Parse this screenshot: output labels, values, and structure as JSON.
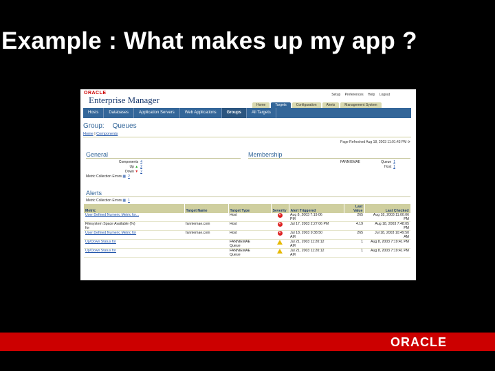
{
  "slide": {
    "title": "Example : What makes up my app ?",
    "footer_logo": "ORACLE"
  },
  "em": {
    "logo": "ORACLE",
    "title": "Enterprise Manager",
    "top_links": [
      "Setup",
      "Preferences",
      "Help",
      "Logout"
    ],
    "tabs": [
      "Home",
      "Targets",
      "Configuration",
      "Alerts",
      "Management System"
    ],
    "subnav": [
      "Hosts",
      "Databases",
      "Application Servers",
      "Web Applications",
      "Groups",
      "All Targets"
    ],
    "page_header": {
      "group": "Group:",
      "name": "Queues"
    },
    "breadcrumb": {
      "home": "Home",
      "current": "Components"
    },
    "refresh": "Page Refreshed Aug 18, 2003 11:01:43 PM",
    "general": {
      "title": "General",
      "rows": [
        {
          "label": "Components",
          "value": "4"
        },
        {
          "label": "Up",
          "value": "2"
        },
        {
          "label": "Down",
          "value": "2"
        },
        {
          "label": "Metric Collection Errors",
          "value": "2"
        }
      ]
    },
    "membership": {
      "title": "Membership",
      "owner": "FANNIEMAE",
      "items": [
        {
          "label": "Queue",
          "value": "1"
        },
        {
          "label": "Host",
          "value": "1"
        }
      ]
    },
    "alerts": {
      "title": "Alerts",
      "mce_label": "Metric Collection Errors",
      "mce_value": "1",
      "columns": [
        "Metric",
        "Target Name",
        "Target Type",
        "Severity",
        "Alert Triggered",
        "Last Value",
        "Last Checked"
      ],
      "rows": [
        {
          "metric": "User Defined Numeric Metric for...",
          "target": "",
          "type": "Host",
          "severity": "critical",
          "triggered": "Aug 8, 2003 7:19:06",
          "triggered2": "PM",
          "value": "265",
          "checked": "Aug 18, 2003 11:00:06",
          "checked2": "PM"
        },
        {
          "metric": "Filesystem Space Available (%)",
          "metric2": "for",
          "target": "fanniemae.com",
          "type": "Host",
          "severity": "critical",
          "triggered": "Jul 17, 2003 2:27:06 PM",
          "triggered2": "",
          "value": "4.19",
          "checked": "Aug 18, 2003 7:48:05",
          "checked2": "PM"
        },
        {
          "metric": "User Defined Numeric Metric for",
          "target": "fanniemae.com",
          "type": "Host",
          "severity": "critical",
          "triggered": "Jul 18, 2003 9:38:50",
          "triggered2": "AM",
          "value": "265",
          "checked": "Jul 18, 2003 10:49:50",
          "checked2": "AM"
        },
        {
          "metric": "Up/Down Status for",
          "target": "",
          "type": "FANNIEMAE",
          "type2": "Queue",
          "severity": "warning",
          "triggered": "Jul 21, 2003 11:20:12",
          "triggered2": "AM",
          "value": "1",
          "checked": "Aug 8, 2003 7:19:41 PM",
          "checked2": ""
        },
        {
          "metric": "Up/Down Status for",
          "target": "",
          "type": "FANNIEMAE",
          "type2": "Queue",
          "severity": "warning",
          "triggered": "Jul 21, 2003 11:20:12",
          "triggered2": "AM",
          "value": "1",
          "checked": "Aug 8, 2003 7:19:41 PM",
          "checked2": ""
        }
      ]
    }
  }
}
